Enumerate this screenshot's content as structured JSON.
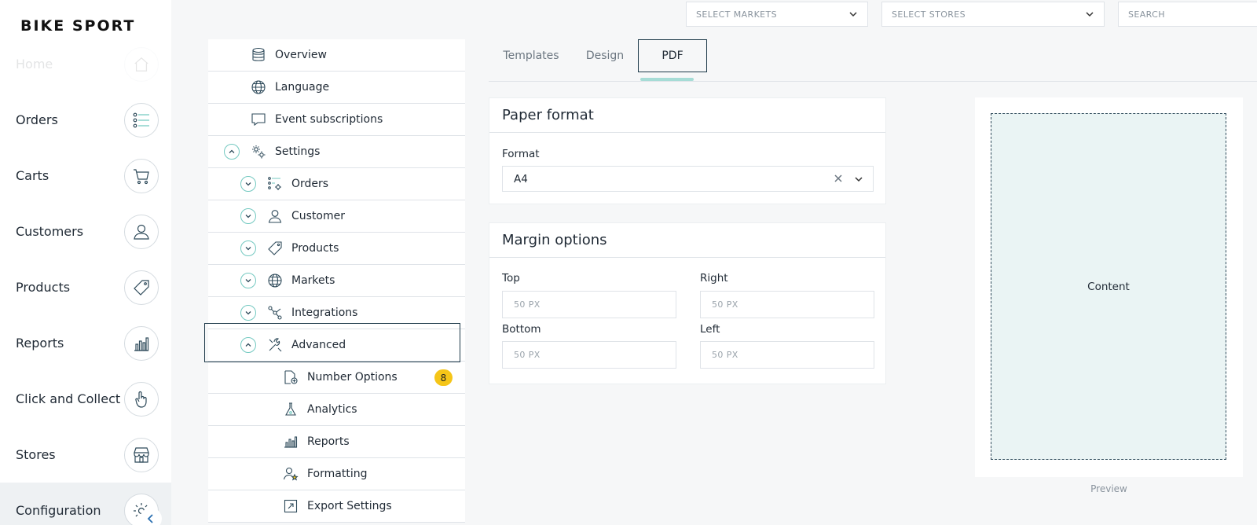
{
  "brand": {
    "logo_text": "BIKE SPORT"
  },
  "nav": {
    "items": [
      {
        "label": "Home",
        "icon": "home-icon"
      },
      {
        "label": "Orders",
        "icon": "list-icon"
      },
      {
        "label": "Carts",
        "icon": "cart-icon"
      },
      {
        "label": "Customers",
        "icon": "user-icon"
      },
      {
        "label": "Products",
        "icon": "tag-icon"
      },
      {
        "label": "Reports",
        "icon": "bar-chart-icon"
      },
      {
        "label": "Click and Collect",
        "icon": "hand-pointer-icon"
      },
      {
        "label": "Stores",
        "icon": "store-icon"
      },
      {
        "label": "Configuration",
        "icon": "gear-icon"
      }
    ],
    "active": "Configuration"
  },
  "topbar": {
    "markets_placeholder": "SELECT MARKETS",
    "stores_placeholder": "SELECT STORES",
    "search_placeholder": "SEARCH"
  },
  "tree": {
    "rows": [
      {
        "label": "Overview",
        "icon": "database-icon"
      },
      {
        "label": "Language",
        "icon": "globe-icon"
      },
      {
        "label": "Event subscriptions",
        "icon": "speech-bubble-icon"
      },
      {
        "label": "Settings",
        "icon": "settings-gears-icon",
        "expanded": true
      },
      {
        "label": "Orders",
        "icon": "list-gear-icon",
        "expanded": false
      },
      {
        "label": "Customer",
        "icon": "user-icon",
        "expanded": false
      },
      {
        "label": "Products",
        "icon": "tag-icon",
        "expanded": false
      },
      {
        "label": "Markets",
        "icon": "globe-icon",
        "expanded": false
      },
      {
        "label": "Integrations",
        "icon": "nodes-icon",
        "expanded": false
      },
      {
        "label": "Advanced",
        "icon": "tools-icon",
        "expanded": true,
        "selected": true
      },
      {
        "label": "Number Options",
        "icon": "document-plus-icon",
        "badge": "8"
      },
      {
        "label": "Analytics",
        "icon": "flask-icon"
      },
      {
        "label": "Reports",
        "icon": "bar-chart-icon"
      },
      {
        "label": "Formatting",
        "icon": "user-star-icon"
      },
      {
        "label": "Export Settings",
        "icon": "export-icon"
      }
    ]
  },
  "tabs": [
    {
      "label": "Templates"
    },
    {
      "label": "Design"
    },
    {
      "label": "PDF",
      "active": true
    }
  ],
  "paper_format": {
    "title": "Paper format",
    "format_label": "Format",
    "format_value": "A4"
  },
  "margin_options": {
    "title": "Margin options",
    "top_label": "Top",
    "right_label": "Right",
    "bottom_label": "Bottom",
    "left_label": "Left",
    "top_placeholder": "50 PX",
    "right_placeholder": "50 PX",
    "bottom_placeholder": "50 PX",
    "left_placeholder": "50 PX"
  },
  "preview": {
    "content_label": "Content",
    "caption": "Preview"
  },
  "colors": {
    "accent": "#74c9c1",
    "badge": "#f5c518",
    "selection_border": "#1e3a4a"
  }
}
